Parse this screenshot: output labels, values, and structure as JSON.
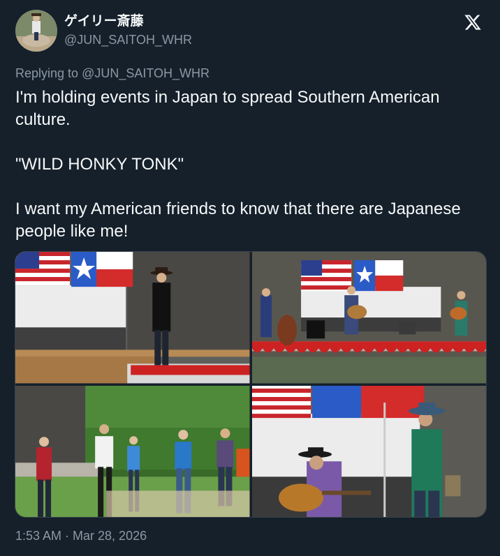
{
  "author": {
    "display_name": "ゲイリー斎藤",
    "handle": "@JUN_SAITOH_WHR"
  },
  "reply": {
    "prefix": "Replying to",
    "mention": "@JUN_SAITOH_WHR"
  },
  "tweet": {
    "paragraphs": [
      "I'm holding events in Japan to spread Southern American culture.",
      "\"WILD HONKY TONK\"",
      "I want my American friends to know that there are Japanese people like me!"
    ]
  },
  "media": {
    "count": 4
  },
  "footer": {
    "timestamp": "1:53 AM · Mar 28, 2026"
  },
  "colors": {
    "background": "#15202b",
    "text": "#f7f9f9",
    "secondary": "#8b98a5",
    "border": "#38444d"
  },
  "icons": [
    "x-logo-icon",
    "avatar"
  ]
}
